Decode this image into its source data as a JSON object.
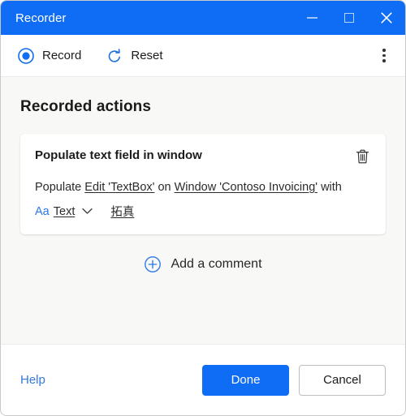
{
  "window": {
    "title": "Recorder",
    "controls": {
      "minimize": "minimize",
      "maximize": "maximize",
      "close": "close"
    }
  },
  "toolbar": {
    "record_label": "Record",
    "reset_label": "Reset",
    "overflow_label": "More options"
  },
  "main": {
    "section_title": "Recorded actions",
    "action_card": {
      "title": "Populate text field in window",
      "delete_label": "Delete",
      "description": {
        "prefix": "Populate",
        "target": "Edit 'TextBox'",
        "connector": "on",
        "window": "Window 'Contoso Invoicing'",
        "suffix": "with"
      },
      "value_row": {
        "type_icon": "Aa",
        "type_label": "Text",
        "value": "拓真"
      }
    },
    "add_comment_label": "Add a comment"
  },
  "footer": {
    "help_label": "Help",
    "done_label": "Done",
    "cancel_label": "Cancel"
  },
  "colors": {
    "accent": "#0f6cf5",
    "link": "#3478e0",
    "body_background": "#f8f8f6",
    "card_background": "#ffffff",
    "text": "#1b1b1b"
  }
}
